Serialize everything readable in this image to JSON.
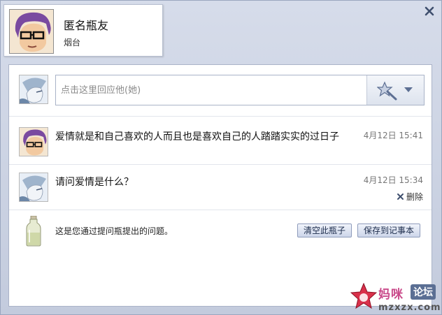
{
  "header": {
    "name": "匿名瓶友",
    "location": "烟台"
  },
  "reply": {
    "placeholder": "点击这里回应他(她)"
  },
  "messages": [
    {
      "text": "爱情就是和自己喜欢的人而且也是喜欢自己的人踏踏实实的过日子",
      "time": "4月12日 15:41"
    },
    {
      "text": "请问爱情是什么？",
      "time": "4月12日 15:34",
      "delete_label": "删除"
    }
  ],
  "footer": {
    "note": "这是您通过提问瓶提出的问题。",
    "clear_button": "清空此瓶子",
    "save_button": "保存到记事本"
  },
  "watermark": {
    "site_cn": "妈咪",
    "badge": "论坛",
    "url": "mzxzx.com"
  },
  "colors": {
    "window_bg": "#c7cfe0",
    "button_border": "#8e9bbb",
    "time_text": "#777777"
  },
  "icons": [
    "close-icon",
    "magic-wand-icon",
    "chevron-down-icon",
    "delete-x-icon",
    "bottle-icon",
    "star-icon"
  ]
}
